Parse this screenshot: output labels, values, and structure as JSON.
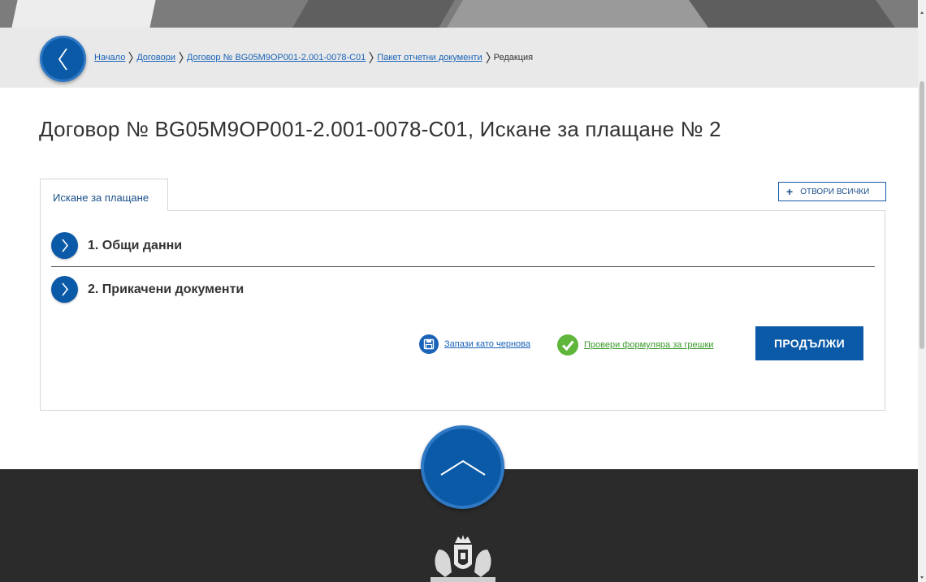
{
  "breadcrumb": {
    "items": [
      "Начало",
      "Договори",
      "Договор № BG05M9OP001-2.001-0078-C01",
      "Пакет отчетни документи"
    ],
    "current": "Редакция"
  },
  "page": {
    "title": "Договор № BG05M9OP001-2.001-0078-C01, Искане за плащане № 2"
  },
  "tabs": [
    {
      "label": "Искане за плащане"
    }
  ],
  "open_all_label": "ОТВОРИ ВСИЧКИ",
  "sections": [
    {
      "label": "1. Общи данни"
    },
    {
      "label": "2. Прикачени документи"
    }
  ],
  "actions": {
    "save_draft": "Запази като чернова",
    "check_form": "Провери формуляра за грешки",
    "continue": "ПРОДЪЛЖИ"
  },
  "icons": {
    "back": "chevron-left-icon",
    "section": "chevron-right-icon",
    "save": "floppy-disk-icon",
    "check": "checkmark-icon",
    "scroll_top": "chevron-up-icon",
    "crest": "coat-of-arms-icon"
  },
  "colors": {
    "primary": "#0b5aa8",
    "link": "#1a63b8",
    "success": "#5fb63b",
    "footer": "#2b2b2b"
  }
}
